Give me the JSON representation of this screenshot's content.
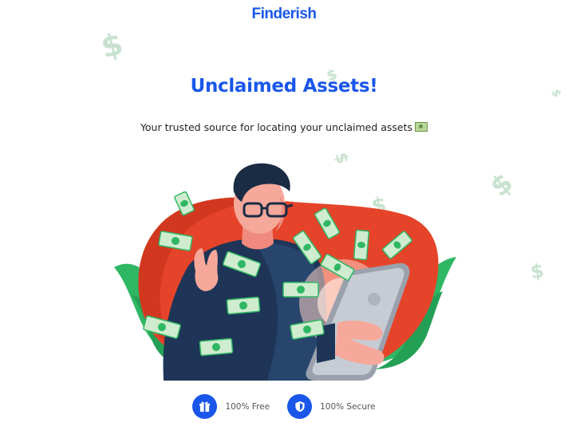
{
  "brand": {
    "name": "Finderish"
  },
  "hero": {
    "headline": "Unclaimed Assets!",
    "subheadline": "Your trusted source for locating your unclaimed assets",
    "subheadline_emoji": "money-bill-icon",
    "illustration": "man-with-tablet-and-flying-money-illustration"
  },
  "features": [
    {
      "label": "100% Free",
      "icon": "gift-icon"
    },
    {
      "label": "100% Secure",
      "icon": "shield-icon"
    }
  ],
  "colors": {
    "brand_blue": "#1a56ea",
    "dollar_green_light": "#c8e2cf",
    "blob_orange": "#e5442a",
    "leaf_green": "#2fb764",
    "shirt_navy": "#1e3557"
  }
}
